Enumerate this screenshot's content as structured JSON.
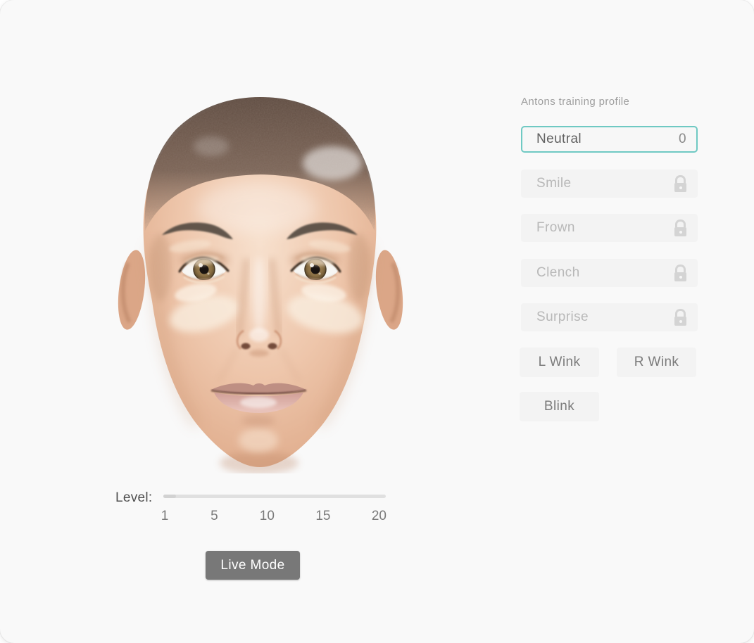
{
  "window": {
    "background": "#f9f9f9",
    "outer_background": "#ffffff"
  },
  "avatar": {
    "description": "neutral-face-shaved-head-avatar"
  },
  "profile_panel": {
    "title": "Antons training profile",
    "expressions": [
      {
        "label": "Neutral",
        "value": "0",
        "selected": true,
        "locked": false
      },
      {
        "label": "Smile",
        "selected": false,
        "locked": true
      },
      {
        "label": "Frown",
        "selected": false,
        "locked": true
      },
      {
        "label": "Clench",
        "selected": false,
        "locked": true
      },
      {
        "label": "Surprise",
        "selected": false,
        "locked": true
      }
    ],
    "action_buttons": [
      {
        "label": "L Wink"
      },
      {
        "label": "R Wink"
      },
      {
        "label": "Blink"
      }
    ]
  },
  "level_control": {
    "label": "Level:",
    "tick_labels": [
      "1",
      "5",
      "10",
      "15",
      "20"
    ],
    "range_min": 1,
    "range_max": 20
  },
  "live_mode": {
    "label": "Live Mode"
  },
  "colors": {
    "accent": "#6fc9c3",
    "card_background": "#f9f9f9",
    "button_background": "#f3f3f3",
    "active_button_background": "#f7f7f7",
    "primary_text": "#616161",
    "muted_text": "#9e9e9e",
    "locked_text": "#b8b8b8",
    "lock_icon": "#d4d4d4",
    "slider_track": "#e0e0e0",
    "live_mode_background": "#787878",
    "live_mode_text": "#ffffff"
  }
}
